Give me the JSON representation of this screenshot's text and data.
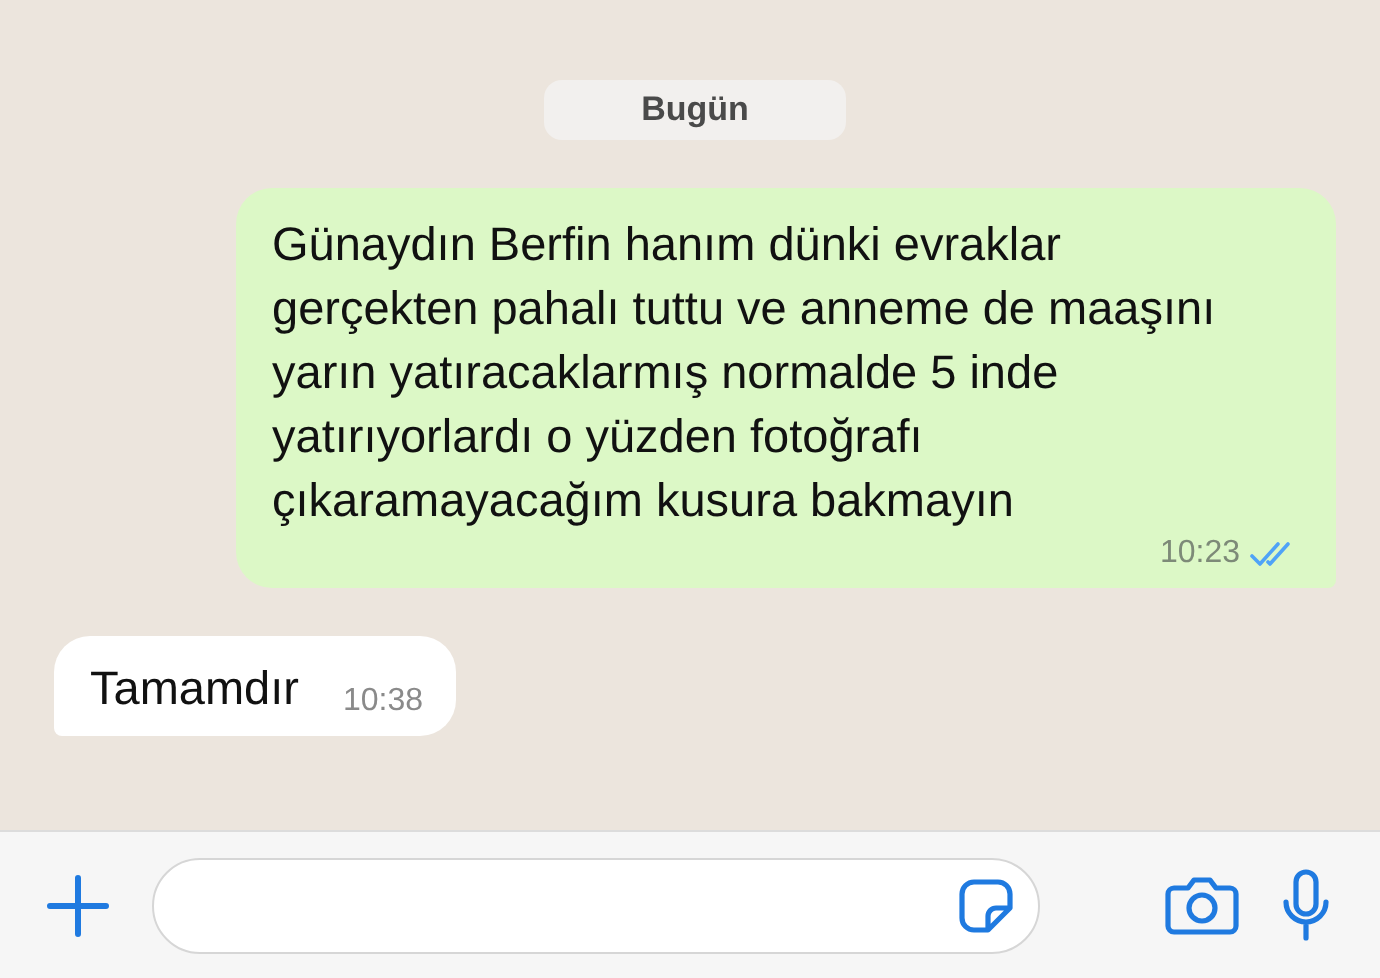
{
  "date_chip": "Bugün",
  "messages": [
    {
      "kind": "outgoing",
      "text": "Günaydın Berfin hanım dünki evraklar gerçekten pahalı tuttu ve anneme de maaşını yarın yatıracaklarmış normalde 5 inde yatırıyorlardı o yüzden fotoğrafı çıkaramayacağım kusura bakmayın",
      "time": "10:23",
      "read": true
    },
    {
      "kind": "incoming",
      "text": "Tamamdır",
      "time": "10:38"
    }
  ]
}
